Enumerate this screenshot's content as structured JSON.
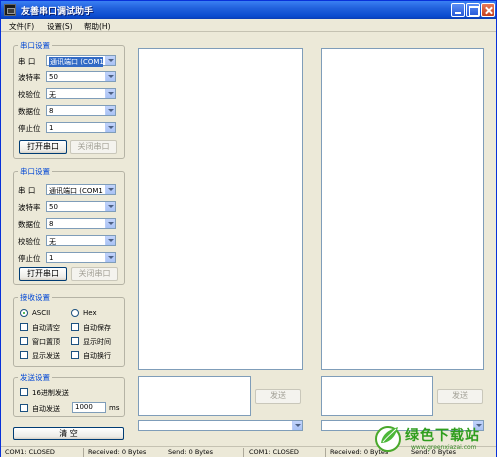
{
  "window": {
    "title": "友善串口调试助手"
  },
  "menu": [
    "文件(F)",
    "设置(S)",
    "帮助(H)"
  ],
  "serial1": {
    "group_title": "串口设置",
    "fields": [
      {
        "label": "串  口",
        "value": "通讯端口 (COM1)"
      },
      {
        "label": "波特率",
        "value": "50"
      },
      {
        "label": "校验位",
        "value": "无"
      },
      {
        "label": "数据位",
        "value": "8"
      },
      {
        "label": "停止位",
        "value": "1"
      }
    ],
    "open_button": "打开串口",
    "close_button": "关闭串口"
  },
  "serial2": {
    "group_title": "串口设置",
    "fields": [
      {
        "label": "串  口",
        "value": "通讯端口 (COM1)"
      },
      {
        "label": "波特率",
        "value": "50"
      },
      {
        "label": "数据位",
        "value": "8"
      },
      {
        "label": "校验位",
        "value": "无"
      },
      {
        "label": "停止位",
        "value": "1"
      }
    ],
    "open_button": "打开串口",
    "close_button": "关闭串口"
  },
  "receive": {
    "group_title": "接收设置",
    "radio_ascii": "ASCII",
    "radio_hex": "Hex",
    "selected": "ASCII",
    "options": [
      "自动清空",
      "自动保存",
      "窗口置顶",
      "显示时间",
      "显示发送",
      "自动换行"
    ]
  },
  "send": {
    "group_title": "发送设置",
    "hex_send": "16进制发送",
    "auto_send": "自动发送",
    "interval": "1000",
    "unit": "ms"
  },
  "clear_button": "清  空",
  "send_button_left": "发送",
  "send_button_right": "发送",
  "status": {
    "left_port": "COM1: CLOSED",
    "left_received": "Received: 0 Bytes",
    "left_send": "Send: 0 Bytes",
    "right_port": "COM1: CLOSED",
    "right_received": "Received: 0 Bytes",
    "right_send": "Send: 0 Bytes"
  },
  "watermark": {
    "text": "绿色下载站",
    "url": "www.greenxiazai.com"
  },
  "colors": {
    "title_bar": "#0A4BCF",
    "group_title": "#0046D5",
    "face": "#ECE9D8"
  }
}
